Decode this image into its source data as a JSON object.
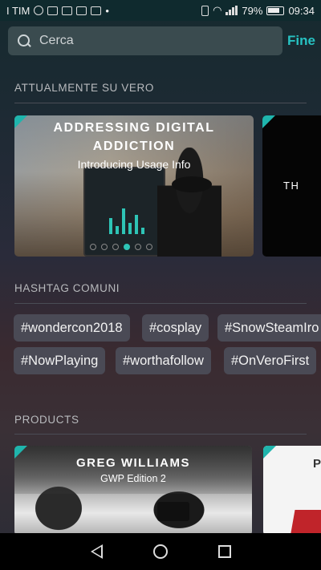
{
  "status_bar": {
    "carrier": "I TIM",
    "battery": "79%",
    "time": "09:34"
  },
  "search": {
    "placeholder": "Cerca",
    "done_label": "Fine"
  },
  "sections": {
    "featured_title": "ATTUALMENTE SU VERO",
    "hashtags_title": "HASHTAG COMUNI",
    "products_title": "PRODUCTS"
  },
  "featured": {
    "card1_title_line1": "ADDRESSING DIGITAL",
    "card1_title_line2": "ADDICTION",
    "card1_subtitle": "Introducing Usage Info",
    "card2_title": "TH"
  },
  "hashtags": [
    "#wondercon2018",
    "#cosplay",
    "#SnowSteamIro",
    "#NowPlaying",
    "#worthafollow",
    "#OnVeroFirst"
  ],
  "products": {
    "card1_title": "GREG WILLIAMS",
    "card1_subtitle": "GWP Edition 2",
    "card2_title": "P"
  },
  "colors": {
    "accent": "#27c2c2",
    "status_bar": "#0f2a2e",
    "chip": "#4a4a55"
  },
  "icons": [
    "search-icon",
    "back-icon",
    "home-icon",
    "recents-icon",
    "wifi-icon",
    "battery-icon",
    "signal-icon",
    "whatsapp-icon",
    "instagram-icon",
    "mail-icon",
    "vibrate-icon"
  ]
}
